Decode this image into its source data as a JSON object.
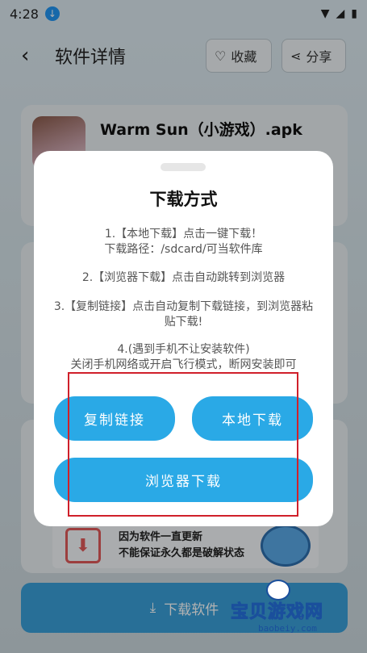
{
  "status": {
    "time": "4:28"
  },
  "header": {
    "back": "<",
    "title": "软件详情",
    "favorite_label": "收藏",
    "share_label": "分享"
  },
  "app": {
    "name": "Warm Sun（小游戏）.apk"
  },
  "promo": {
    "line1": "因为软件一直更新",
    "line2": "不能保证永久都是破解状态"
  },
  "bottom_button": {
    "label": "下载软件"
  },
  "dialog": {
    "title": "下载方式",
    "instructions": [
      "1.【本地下载】点击一键下载！\n下载路径：/sdcard/可当软件库",
      "2.【浏览器下载】点击自动跳转到浏览器",
      "3.【复制链接】点击自动复制下载链接，到浏览器粘贴下载!",
      "4.(遇到手机不让安装软件)\n关闭手机网络或开启飞行模式，断网安装即可"
    ],
    "buttons": {
      "copy": "复制链接",
      "local": "本地下载",
      "browser": "浏览器下载"
    }
  },
  "watermark": {
    "name": "宝贝游戏网",
    "url": "baobeiy.com"
  },
  "colors": {
    "accent": "#2aa9e6",
    "highlight_box": "#d0202a"
  }
}
